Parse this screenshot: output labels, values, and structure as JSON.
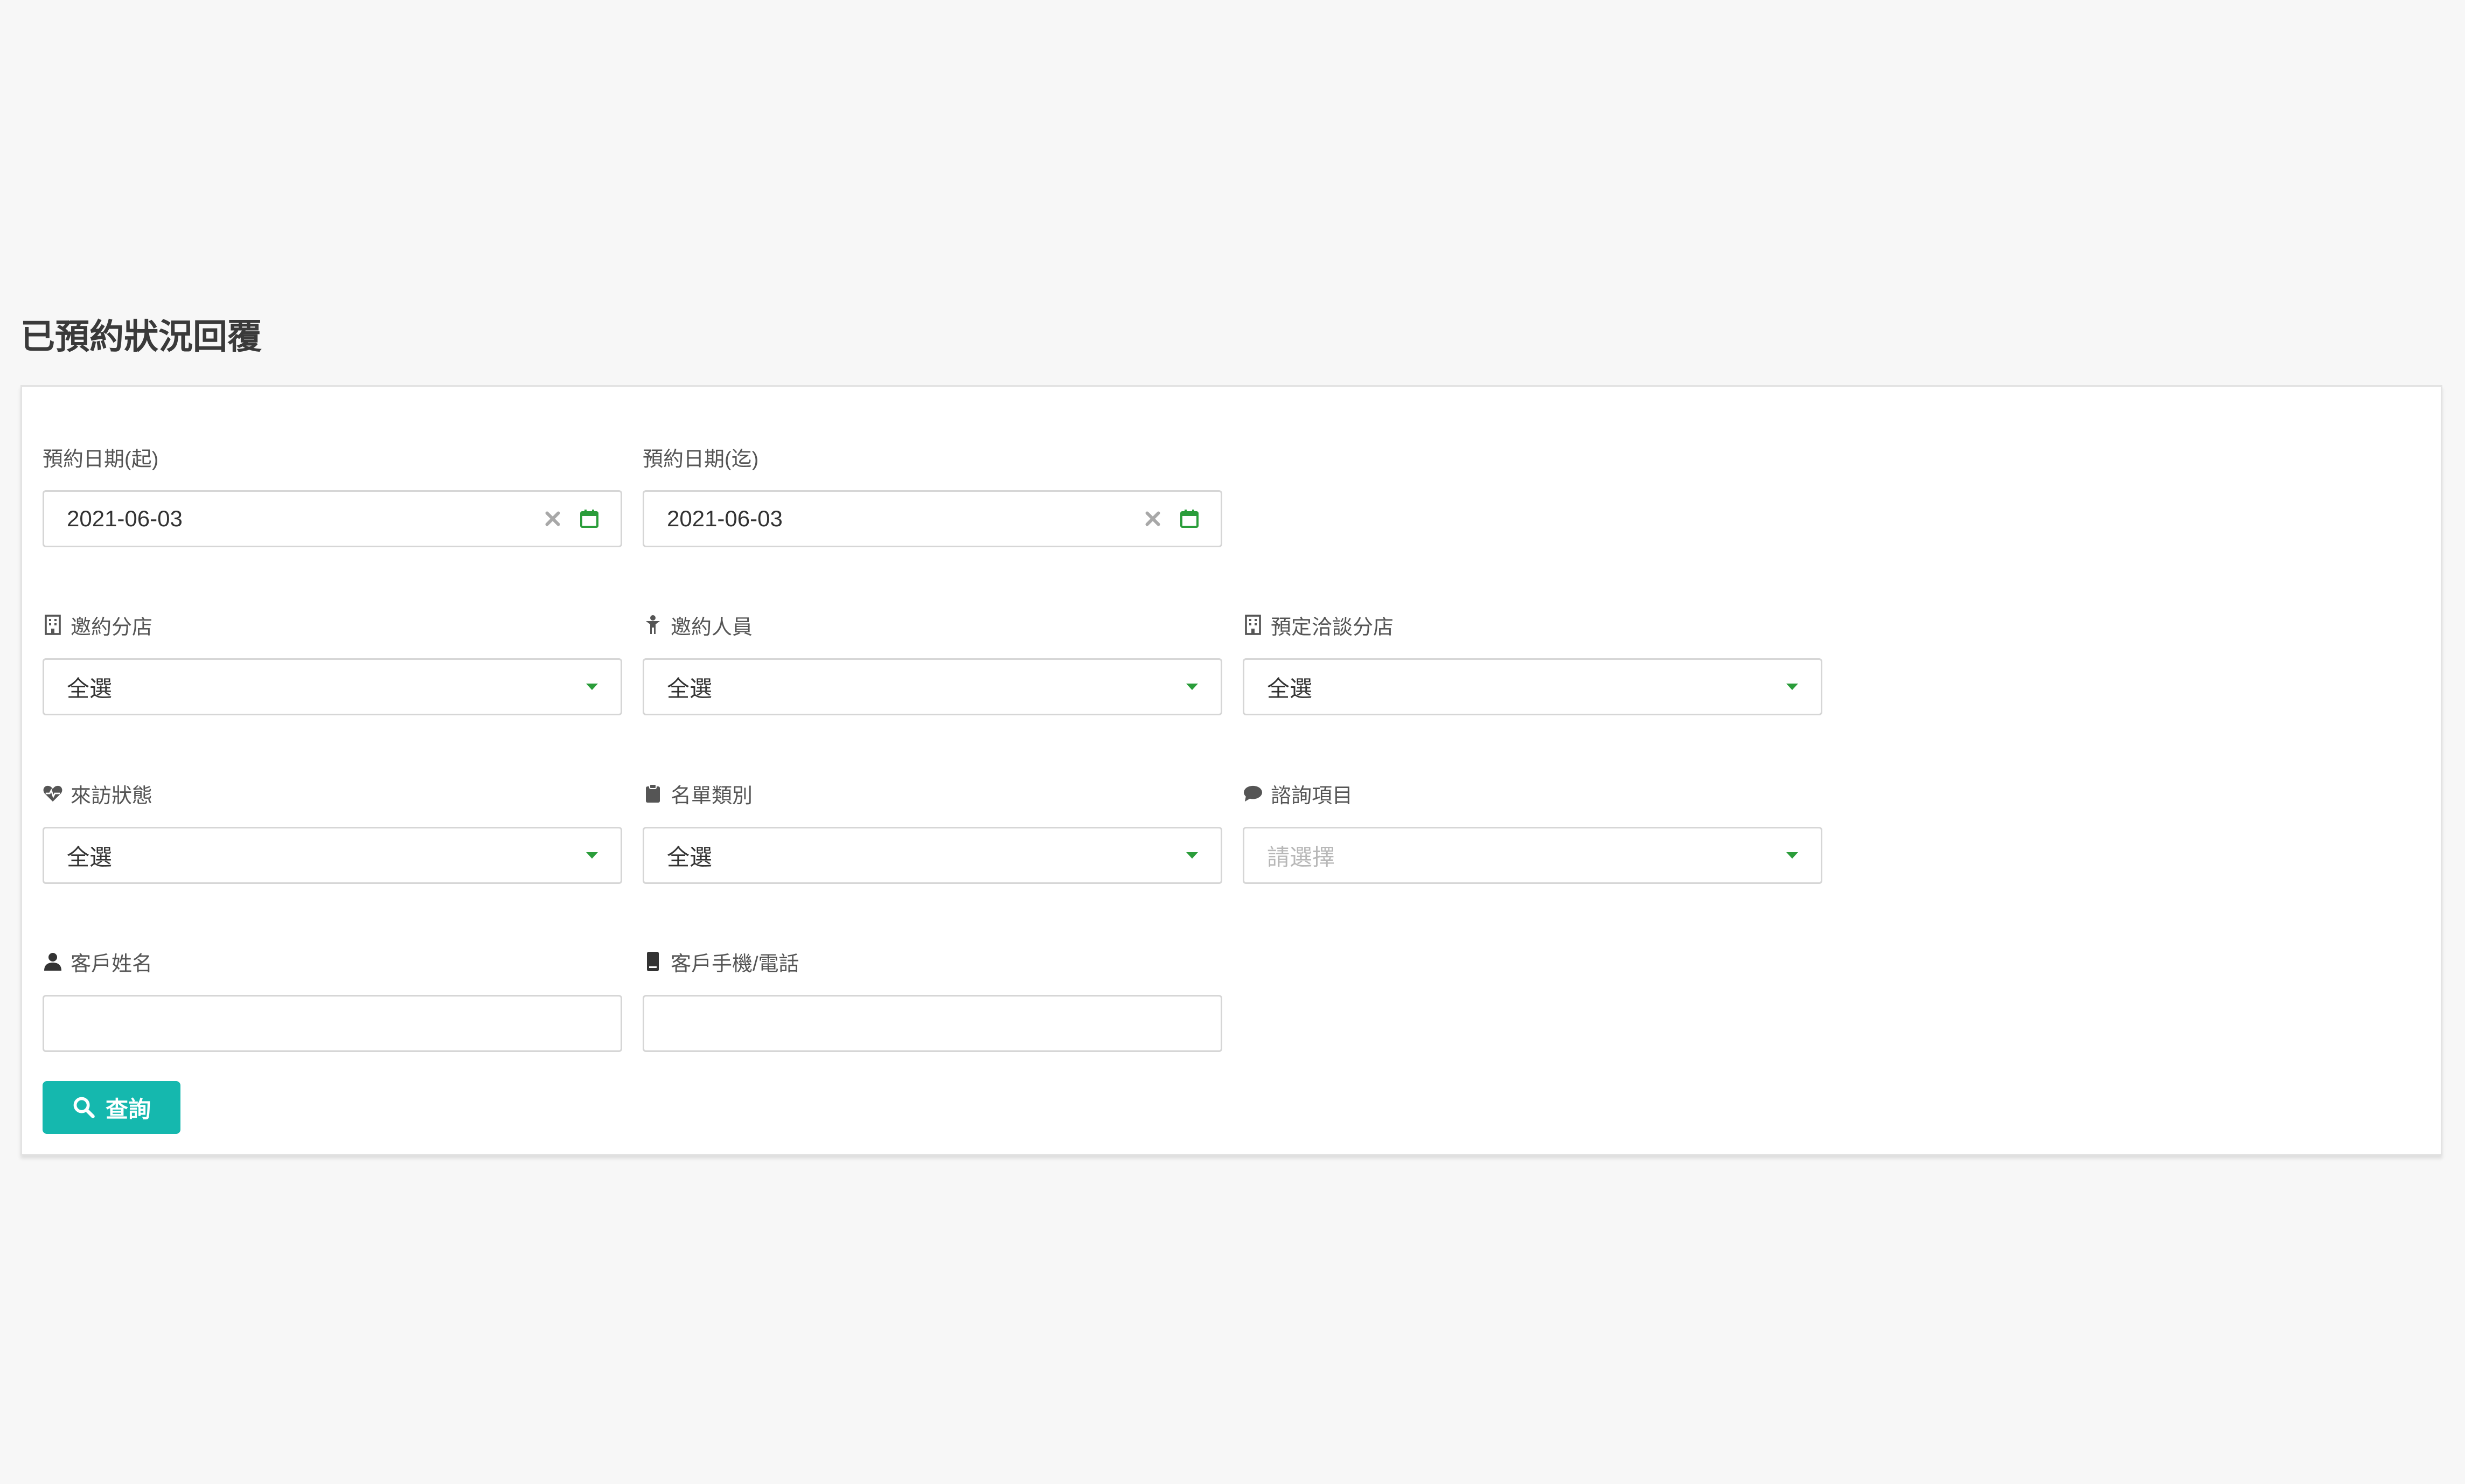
{
  "page": {
    "title": "已預約狀況回覆"
  },
  "colors": {
    "accent": "#15b8ae",
    "calendar_green": "#2a9d3a",
    "border": "#d6d6d6",
    "background": "#f7f7f7"
  },
  "filters": {
    "date_start": {
      "label": "預約日期(起)",
      "value": "2021-06-03",
      "icons": [
        "clear-icon",
        "calendar-icon"
      ]
    },
    "date_end": {
      "label": "預約日期(迄)",
      "value": "2021-06-03",
      "icons": [
        "clear-icon",
        "calendar-icon"
      ]
    },
    "invite_branch": {
      "label": "邀約分店",
      "icon": "building-icon",
      "value": "全選"
    },
    "invite_staff": {
      "label": "邀約人員",
      "icon": "person-icon",
      "value": "全選"
    },
    "planned_branch": {
      "label": "預定洽談分店",
      "icon": "building-icon",
      "value": "全選"
    },
    "visit_status": {
      "label": "來訪狀態",
      "icon": "heartbeat-icon",
      "value": "全選"
    },
    "list_type": {
      "label": "名單類別",
      "icon": "clipboard-icon",
      "value": "全選"
    },
    "consult_item": {
      "label": "諮詢項目",
      "icon": "comment-icon",
      "placeholder": "請選擇"
    },
    "customer_name": {
      "label": "客戶姓名",
      "icon": "user-icon",
      "value": ""
    },
    "customer_phone": {
      "label": "客戶手機/電話",
      "icon": "mobile-icon",
      "value": ""
    }
  },
  "actions": {
    "search_label": "查詢",
    "search_icon": "search-icon"
  }
}
